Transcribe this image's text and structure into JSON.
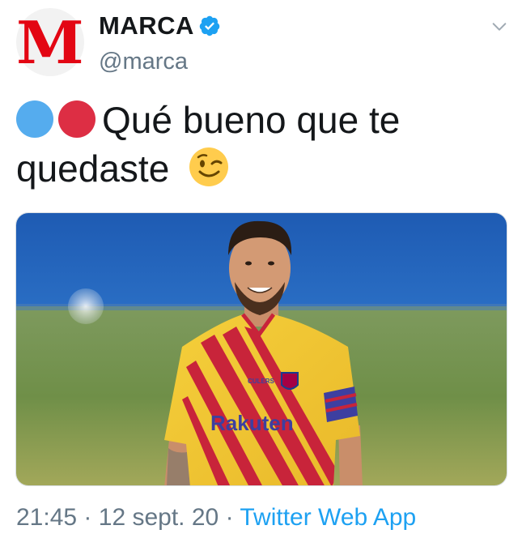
{
  "account": {
    "display_name": "MARCA",
    "handle": "@marca",
    "avatar_letter": "M",
    "verified": true
  },
  "tweet": {
    "text_line1": "Qué bueno que te",
    "text_line2": "quedaste",
    "emoji": [
      "blue-circle",
      "red-circle",
      "winking-face"
    ],
    "media": {
      "alt": "Footballer in yellow Barcelona away kit smiling on the pitch",
      "jersey_text": "Rakuten",
      "collar_text": "CULERS"
    }
  },
  "footer": {
    "time": "21:45",
    "separator": "·",
    "date": "12 sept. 20",
    "source": "Twitter Web App"
  },
  "colors": {
    "brand_red": "#e30613",
    "twitter_blue": "#1da1f2",
    "secondary_text": "#657786",
    "verified_blue": "#1da1f2"
  }
}
